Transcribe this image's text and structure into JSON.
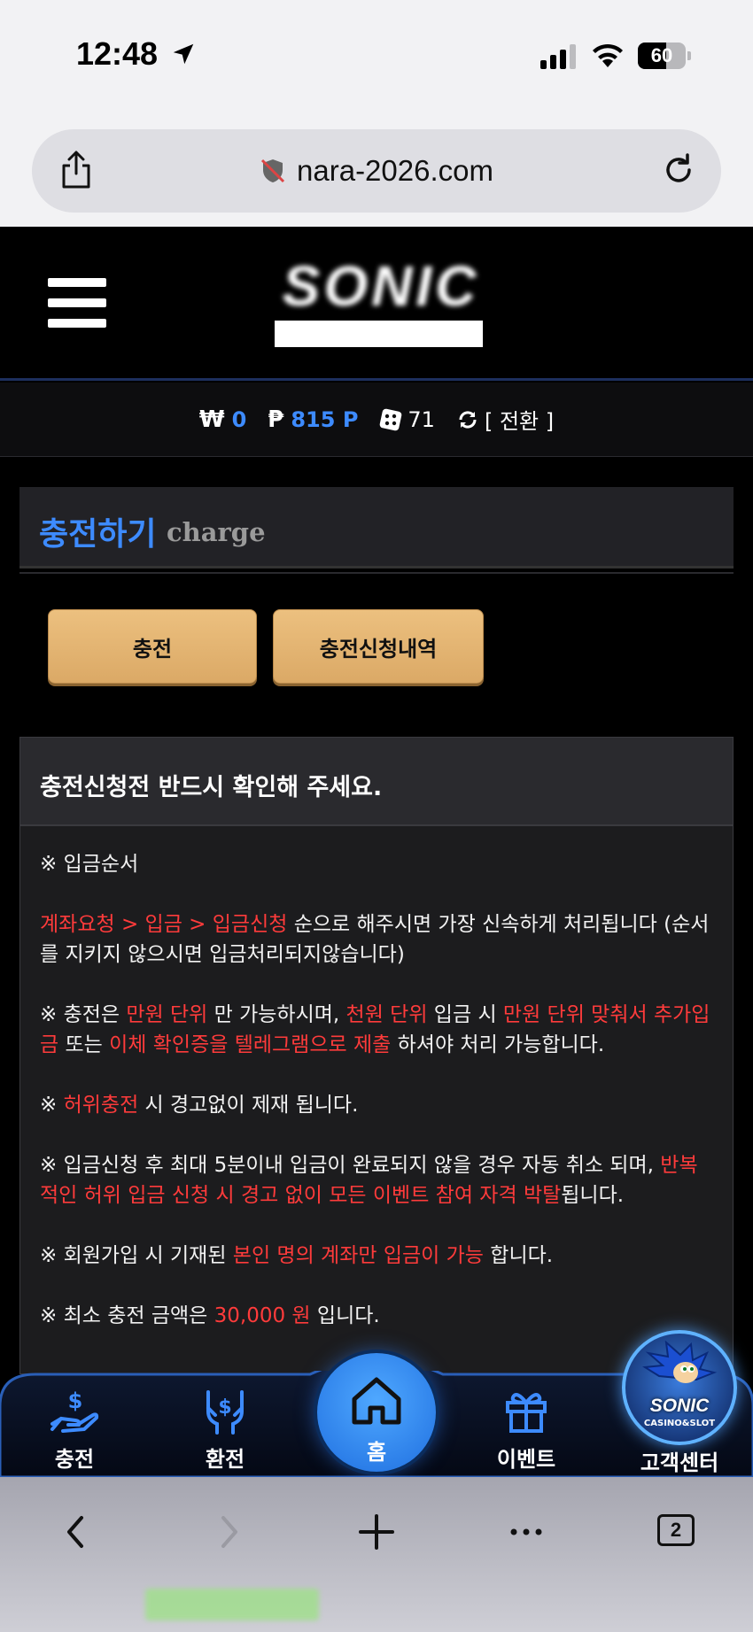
{
  "status_bar": {
    "time": "12:48",
    "battery_percent": "60",
    "battery_level": 0.6
  },
  "browser": {
    "url": "nara-2026.com",
    "tabs_count": "2"
  },
  "header": {
    "logo_text": "SONIC"
  },
  "balance": {
    "won_symbol": "₩",
    "won_value": "0",
    "point_symbol": "₱",
    "point_value": "815 P",
    "dice_value": "71",
    "switch_label": "[ 전환 ]"
  },
  "page_title": {
    "ko": "충전하기",
    "en": "charge"
  },
  "buttons": {
    "charge": "충전",
    "history": "충전신청내역"
  },
  "notice": {
    "heading": "충전신청전 반드시 확인해 주세요.",
    "order_title": "※ 입금순서",
    "order_red": "계좌요청 > 입금 > 입금신청",
    "order_rest": " 순으로 해주시면 가장 신속하게 처리됩니다 (순서를 지키지 않으시면 입금처리되지않습니다)",
    "unit_a": "※ 충전은 ",
    "unit_b_red": "만원 단위",
    "unit_c": " 만 가능하시며, ",
    "unit_d_red": "천원 단위",
    "unit_e": " 입금 시 ",
    "unit_f_red": "만원 단위 맞춰서 추가입금",
    "unit_g": " 또는 ",
    "unit_h_red": "이체 확인증을 텔레그램으로 제출",
    "unit_i": " 하셔야 처리 가능합니다.",
    "fake_a": "※ ",
    "fake_b_red": "허위충전",
    "fake_c": " 시 경고없이 제재 됩니다.",
    "cancel_a": "※ 입금신청 후 최대 5분이내 입금이 완료되지 않을 경우 자동 취소 되며, ",
    "cancel_b_red": "반복적인 허위 입금 신청 시 경고 없이 모든 이벤트 참여 자격 박탈",
    "cancel_c": "됩니다.",
    "account_a": "※ 회원가입 시 기재된 ",
    "account_b_red": "본인 명의 계좌만 입금이 가능",
    "account_c": " 합니다.",
    "min_a": "※ 최소 충전 금액은 ",
    "min_b_red": "30,000 원",
    "min_c": " 입니다."
  },
  "bottom_nav": {
    "charge": "충전",
    "exchange": "환전",
    "home": "홈",
    "event": "이벤트",
    "support": "고객센터",
    "support_avatar_title": "SONIC",
    "support_avatar_sub": "CASINO&SLOT"
  },
  "colors": {
    "accent_blue": "#3d8bff",
    "warning_red": "#ff3b3b",
    "button_gold": "#e3b571"
  }
}
